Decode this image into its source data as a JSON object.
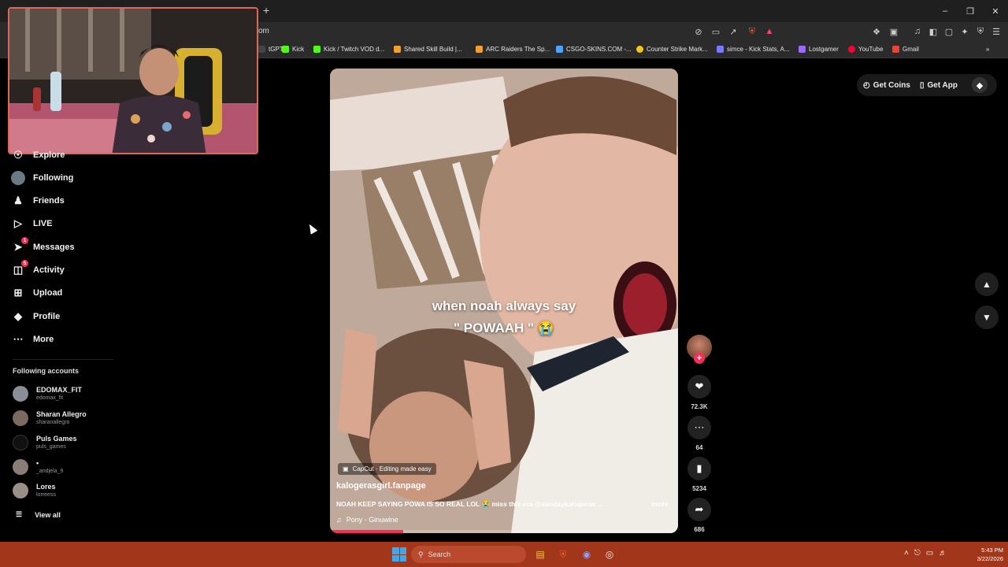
{
  "browser": {
    "new_tab_icon": "plus-icon",
    "url_text": "om",
    "bookmarks": [
      {
        "label": "tGPT",
        "color": "#444444"
      },
      {
        "label": "Kick",
        "color": "#53fc18"
      },
      {
        "label": "Kick / Twitch VOD d...",
        "color": "#53fc18"
      },
      {
        "label": "Shared Skill Build |...",
        "color": "#f0a030"
      },
      {
        "label": "ARC Raiders The Sp...",
        "color": "#f0a030"
      },
      {
        "label": "CSGO-SKINS.COM -...",
        "color": "#4da3ff"
      },
      {
        "label": "Counter Strike Mark...",
        "color": "#f5c518"
      },
      {
        "label": "simce - Kick Stats, A...",
        "color": "#7a7aff"
      },
      {
        "label": "Lostgamer",
        "color": "#9b6bff"
      },
      {
        "label": "YouTube",
        "color": "#ff0033"
      },
      {
        "label": "Gmail",
        "color": "#ea4335"
      }
    ]
  },
  "sidebar": {
    "items": [
      {
        "label": "Explore",
        "icon": "compass-icon"
      },
      {
        "label": "Following",
        "icon": "following-avatar-icon"
      },
      {
        "label": "Friends",
        "icon": "friends-icon"
      },
      {
        "label": "LIVE",
        "icon": "live-icon"
      },
      {
        "label": "Messages",
        "icon": "messages-icon",
        "badge": "1"
      },
      {
        "label": "Activity",
        "icon": "activity-icon",
        "badge": "5"
      },
      {
        "label": "Upload",
        "icon": "upload-icon"
      },
      {
        "label": "Profile",
        "icon": "profile-icon"
      },
      {
        "label": "More",
        "icon": "more-icon"
      }
    ],
    "following_heading": "Following accounts",
    "accounts": [
      {
        "name": "EDOMAX_FIT",
        "handle": "edomax_fit"
      },
      {
        "name": "Sharan Allegro",
        "handle": "sharanallegro"
      },
      {
        "name": "Puls Games",
        "handle": "puls_games"
      },
      {
        "name": "•",
        "handle": "_andjela_9"
      },
      {
        "name": "Lores",
        "handle": "lorreess"
      }
    ],
    "view_all": "View all"
  },
  "topbar": {
    "get_coins": "Get Coins",
    "get_app": "Get App"
  },
  "video": {
    "caption_line1": "when noah always say",
    "caption_line2": "\" POWAAH \" 😭",
    "capcut": "CapCut · Editing made easy",
    "author": "kalogerasgirl.fanpage",
    "description": "NOAH KEEP SAYING POWA IS SO REAL LOL 😭 miss this era @sundaykalogeras ...",
    "more": "more",
    "music": "Pony - Ginuwine",
    "progress": 0.21
  },
  "actions": {
    "likes": "72.3K",
    "comments": "64",
    "saves": "5234",
    "shares": "686"
  },
  "taskbar": {
    "search_placeholder": "Search",
    "time": "5:43 PM",
    "date": "3/22/2026"
  },
  "colors": {
    "accent": "#fe2c55",
    "taskbar": "#a1361a"
  }
}
